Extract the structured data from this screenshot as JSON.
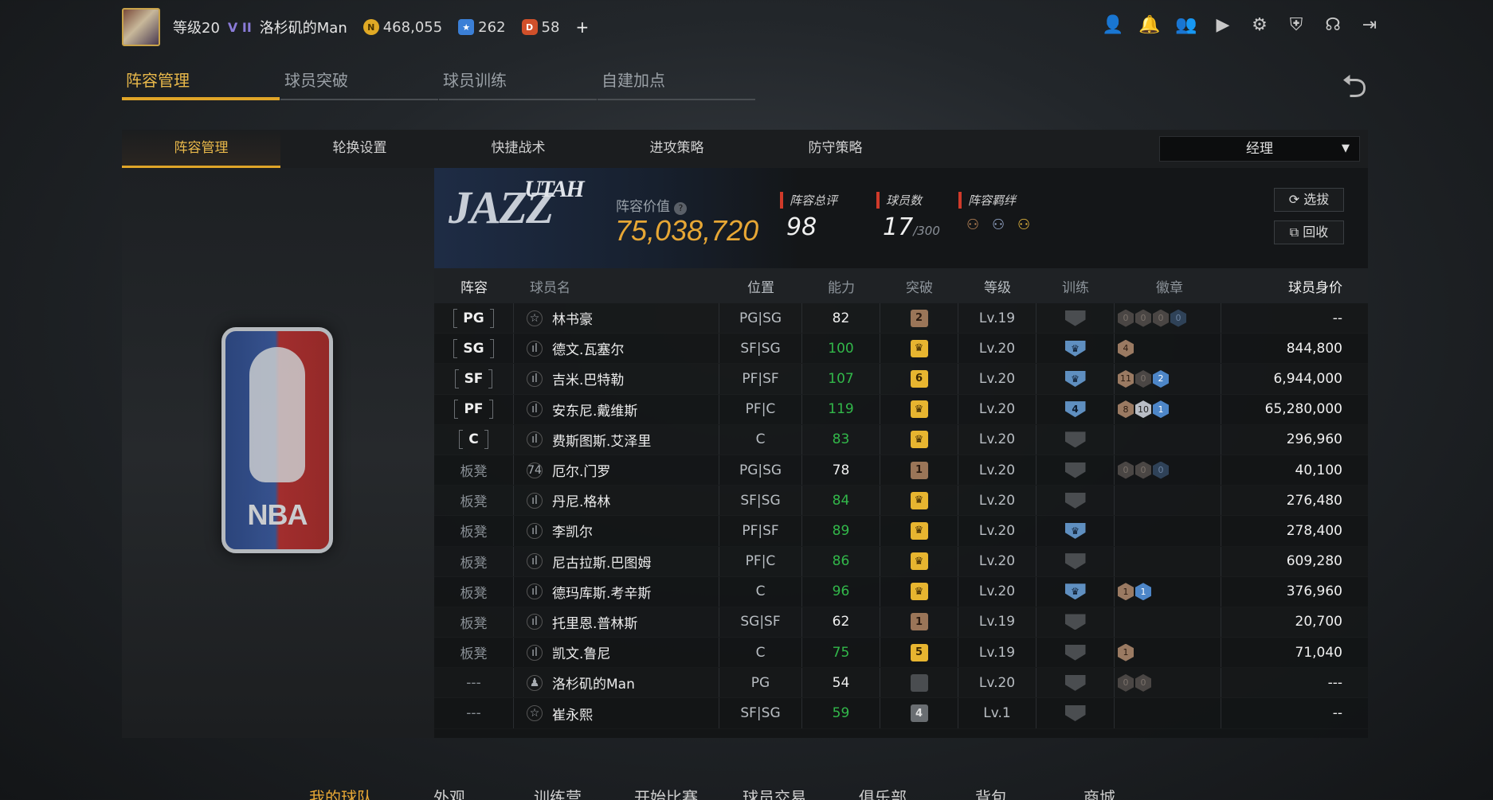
{
  "player": {
    "level": "等级20",
    "rank_icon": "V II",
    "name": "洛杉矶的Man"
  },
  "currency": [
    {
      "icon": "N",
      "value": "468,055",
      "color": "#e0a925"
    },
    {
      "icon": "★",
      "value": "262",
      "color": "#3b7fd6"
    },
    {
      "icon": "D",
      "value": "58",
      "color": "#d0502a"
    }
  ],
  "currency_plus": "+",
  "top_icons": [
    "person-icon",
    "bell-icon",
    "friends-icon",
    "video-icon",
    "gear-icon",
    "shield-icon",
    "headset-icon",
    "exit-icon"
  ],
  "main_tabs": [
    "阵容管理",
    "球员突破",
    "球员训练",
    "自建加点"
  ],
  "sub_tabs": [
    "阵容管理",
    "轮换设置",
    "快捷战术",
    "进攻策略",
    "防守策略"
  ],
  "dropdown": {
    "value": "经理"
  },
  "team": {
    "logo_text": "JAZZ",
    "logo_sub": "UTAH"
  },
  "lineup_value": {
    "label": "阵容价值",
    "value": "75,038,720"
  },
  "stats": {
    "rating": {
      "label": "阵容总评",
      "value": "98"
    },
    "players": {
      "label": "球员数",
      "value": "17",
      "max": "/300"
    },
    "bonds": {
      "label": "阵容羁绊"
    }
  },
  "buttons": {
    "select": "选拔",
    "recycle": "回收"
  },
  "table": {
    "headers": [
      "阵容",
      "球员名",
      "位置",
      "能力",
      "突破",
      "等级",
      "训练",
      "徽章",
      "球员身价"
    ],
    "rows": [
      {
        "slot": "PG",
        "bench": false,
        "icon": "☆",
        "name": "林书豪",
        "pos": "PG|SG",
        "ovr": "82",
        "ovr_green": false,
        "brk": "2",
        "brk_type": "bronze",
        "lvl": "Lv.19",
        "trn": "",
        "trn_on": false,
        "badges": [
          [
            "0",
            "d"
          ],
          [
            "0",
            "d"
          ],
          [
            "0",
            "d"
          ],
          [
            "0",
            "dbl"
          ]
        ],
        "value": "--"
      },
      {
        "slot": "SG",
        "bench": false,
        "icon": "ıl",
        "name": "德文.瓦塞尔",
        "pos": "SF|SG",
        "ovr": "100",
        "ovr_green": true,
        "brk": "♛",
        "brk_type": "gold",
        "lvl": "Lv.20",
        "trn": "♛",
        "trn_on": true,
        "badges": [
          [
            "4",
            "b"
          ]
        ],
        "value": "844,800"
      },
      {
        "slot": "SF",
        "bench": false,
        "icon": "ıl",
        "name": "吉米.巴特勒",
        "pos": "PF|SF",
        "ovr": "107",
        "ovr_green": true,
        "brk": "6",
        "brk_type": "gold",
        "lvl": "Lv.20",
        "trn": "♛",
        "trn_on": true,
        "badges": [
          [
            "11",
            "b"
          ],
          [
            "0",
            "d"
          ],
          [
            "2",
            "bl"
          ]
        ],
        "value": "6,944,000"
      },
      {
        "slot": "PF",
        "bench": false,
        "icon": "ıl",
        "name": "安东尼.戴维斯",
        "pos": "PF|C",
        "ovr": "119",
        "ovr_green": true,
        "brk": "♛",
        "brk_type": "gold",
        "lvl": "Lv.20",
        "trn": "4",
        "trn_on": true,
        "badges": [
          [
            "8",
            "b"
          ],
          [
            "10",
            "s"
          ],
          [
            "1",
            "bl"
          ]
        ],
        "value": "65,280,000"
      },
      {
        "slot": "C",
        "bench": false,
        "icon": "ıl",
        "name": "费斯图斯.艾泽里",
        "pos": "C",
        "ovr": "83",
        "ovr_green": true,
        "brk": "♛",
        "brk_type": "gold",
        "lvl": "Lv.20",
        "trn": "",
        "trn_on": false,
        "badges": [],
        "value": "296,960"
      },
      {
        "slot": "板凳",
        "bench": true,
        "icon": "74",
        "name": "厄尔.门罗",
        "pos": "PG|SG",
        "ovr": "78",
        "ovr_green": false,
        "brk": "1",
        "brk_type": "bronze",
        "lvl": "Lv.20",
        "trn": "",
        "trn_on": false,
        "badges": [
          [
            "0",
            "d"
          ],
          [
            "0",
            "d"
          ],
          [
            "0",
            "dbl"
          ]
        ],
        "value": "40,100"
      },
      {
        "slot": "板凳",
        "bench": true,
        "icon": "ıl",
        "name": "丹尼.格林",
        "pos": "SF|SG",
        "ovr": "84",
        "ovr_green": true,
        "brk": "♛",
        "brk_type": "gold",
        "lvl": "Lv.20",
        "trn": "",
        "trn_on": false,
        "badges": [],
        "value": "276,480"
      },
      {
        "slot": "板凳",
        "bench": true,
        "icon": "ıl",
        "name": "李凯尔",
        "pos": "PF|SF",
        "ovr": "89",
        "ovr_green": true,
        "brk": "♛",
        "brk_type": "gold",
        "lvl": "Lv.20",
        "trn": "♛",
        "trn_on": true,
        "badges": [],
        "value": "278,400"
      },
      {
        "slot": "板凳",
        "bench": true,
        "icon": "ıl",
        "name": "尼古拉斯.巴图姆",
        "pos": "PF|C",
        "ovr": "86",
        "ovr_green": true,
        "brk": "♛",
        "brk_type": "gold",
        "lvl": "Lv.20",
        "trn": "",
        "trn_on": false,
        "badges": [],
        "value": "609,280"
      },
      {
        "slot": "板凳",
        "bench": true,
        "icon": "ıl",
        "name": "德玛库斯.考辛斯",
        "pos": "C",
        "ovr": "96",
        "ovr_green": true,
        "brk": "♛",
        "brk_type": "gold",
        "lvl": "Lv.20",
        "trn": "♛",
        "trn_on": true,
        "badges": [
          [
            "1",
            "b"
          ],
          [
            "1",
            "bl"
          ]
        ],
        "value": "376,960"
      },
      {
        "slot": "板凳",
        "bench": true,
        "icon": "ıl",
        "name": "托里恩.普林斯",
        "pos": "SG|SF",
        "ovr": "62",
        "ovr_green": false,
        "brk": "1",
        "brk_type": "bronze",
        "lvl": "Lv.19",
        "trn": "",
        "trn_on": false,
        "badges": [],
        "value": "20,700"
      },
      {
        "slot": "板凳",
        "bench": true,
        "icon": "ıl",
        "name": "凯文.鲁尼",
        "pos": "C",
        "ovr": "75",
        "ovr_green": true,
        "brk": "5",
        "brk_type": "gold",
        "lvl": "Lv.19",
        "trn": "",
        "trn_on": false,
        "badges": [
          [
            "1",
            "b"
          ]
        ],
        "value": "71,040"
      },
      {
        "slot": "---",
        "bench": true,
        "icon": "♟",
        "name": "洛杉矶的Man",
        "pos": "PG",
        "ovr": "54",
        "ovr_green": false,
        "brk": "",
        "brk_type": "dark",
        "lvl": "Lv.20",
        "trn": "",
        "trn_on": false,
        "badges": [
          [
            "0",
            "d"
          ],
          [
            "0",
            "d"
          ]
        ],
        "value": "---"
      },
      {
        "slot": "---",
        "bench": true,
        "icon": "☆",
        "name": "崔永熙",
        "pos": "SF|SG",
        "ovr": "59",
        "ovr_green": true,
        "brk": "4",
        "brk_type": "grey",
        "lvl": "Lv.1",
        "trn": "",
        "trn_on": false,
        "badges": [],
        "value": "--"
      }
    ]
  },
  "bottom_nav": [
    "我的球队",
    "外观",
    "训练营",
    "开始比赛",
    "球员交易",
    "俱乐部",
    "背包",
    "商城"
  ],
  "colors": {
    "accent": "#e0a528",
    "value": "#e7a735",
    "green": "#32b84a",
    "red_tag": "#d03a2a"
  }
}
